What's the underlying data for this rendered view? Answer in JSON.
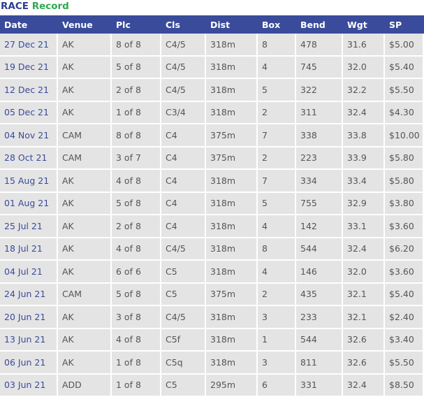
{
  "title": {
    "part1": "RACE",
    "part2": "Record"
  },
  "columns": [
    "Date",
    "Venue",
    "Plc",
    "Cls",
    "Dist",
    "Box",
    "Bend",
    "Wgt",
    "SP"
  ],
  "rows": [
    [
      "27 Dec 21",
      "AK",
      "8 of 8",
      "C4/5",
      "318m",
      "8",
      "478",
      "31.6",
      "$5.00"
    ],
    [
      "19 Dec 21",
      "AK",
      "5 of 8",
      "C4/5",
      "318m",
      "4",
      "745",
      "32.0",
      "$5.40"
    ],
    [
      "12 Dec 21",
      "AK",
      "2 of 8",
      "C4/5",
      "318m",
      "5",
      "322",
      "32.2",
      "$5.50"
    ],
    [
      "05 Dec 21",
      "AK",
      "1 of 8",
      "C3/4",
      "318m",
      "2",
      "311",
      "32.4",
      "$4.30"
    ],
    [
      "04 Nov 21",
      "CAM",
      "8 of 8",
      "C4",
      "375m",
      "7",
      "338",
      "33.8",
      "$10.00"
    ],
    [
      "28 Oct 21",
      "CAM",
      "3 of 7",
      "C4",
      "375m",
      "2",
      "223",
      "33.9",
      "$5.80"
    ],
    [
      "15 Aug 21",
      "AK",
      "4 of 8",
      "C4",
      "318m",
      "7",
      "334",
      "33.4",
      "$5.80"
    ],
    [
      "01 Aug 21",
      "AK",
      "5 of 8",
      "C4",
      "318m",
      "5",
      "755",
      "32.9",
      "$3.80"
    ],
    [
      "25 Jul 21",
      "AK",
      "2 of 8",
      "C4",
      "318m",
      "4",
      "142",
      "33.1",
      "$3.60"
    ],
    [
      "18 Jul 21",
      "AK",
      "4 of 8",
      "C4/5",
      "318m",
      "8",
      "544",
      "32.4",
      "$6.20"
    ],
    [
      "04 Jul 21",
      "AK",
      "6 of 6",
      "C5",
      "318m",
      "4",
      "146",
      "32.0",
      "$3.60"
    ],
    [
      "24 Jun 21",
      "CAM",
      "5 of 8",
      "C5",
      "375m",
      "2",
      "435",
      "32.1",
      "$5.40"
    ],
    [
      "20 Jun 21",
      "AK",
      "3 of 8",
      "C4/5",
      "318m",
      "3",
      "233",
      "32.1",
      "$2.40"
    ],
    [
      "13 Jun 21",
      "AK",
      "4 of 8",
      "C5f",
      "318m",
      "1",
      "544",
      "32.6",
      "$3.40"
    ],
    [
      "06 Jun 21",
      "AK",
      "1 of 8",
      "C5q",
      "318m",
      "3",
      "811",
      "32.6",
      "$5.50"
    ],
    [
      "03 Jun 21",
      "ADD",
      "1 of 8",
      "C5",
      "295m",
      "6",
      "331",
      "32.4",
      "$8.50"
    ]
  ],
  "colors": {
    "header_bg": "#3a4b9b",
    "row_bg": "#e4e4e4",
    "title_race": "#2e3d8f",
    "title_record": "#2eaa50"
  }
}
